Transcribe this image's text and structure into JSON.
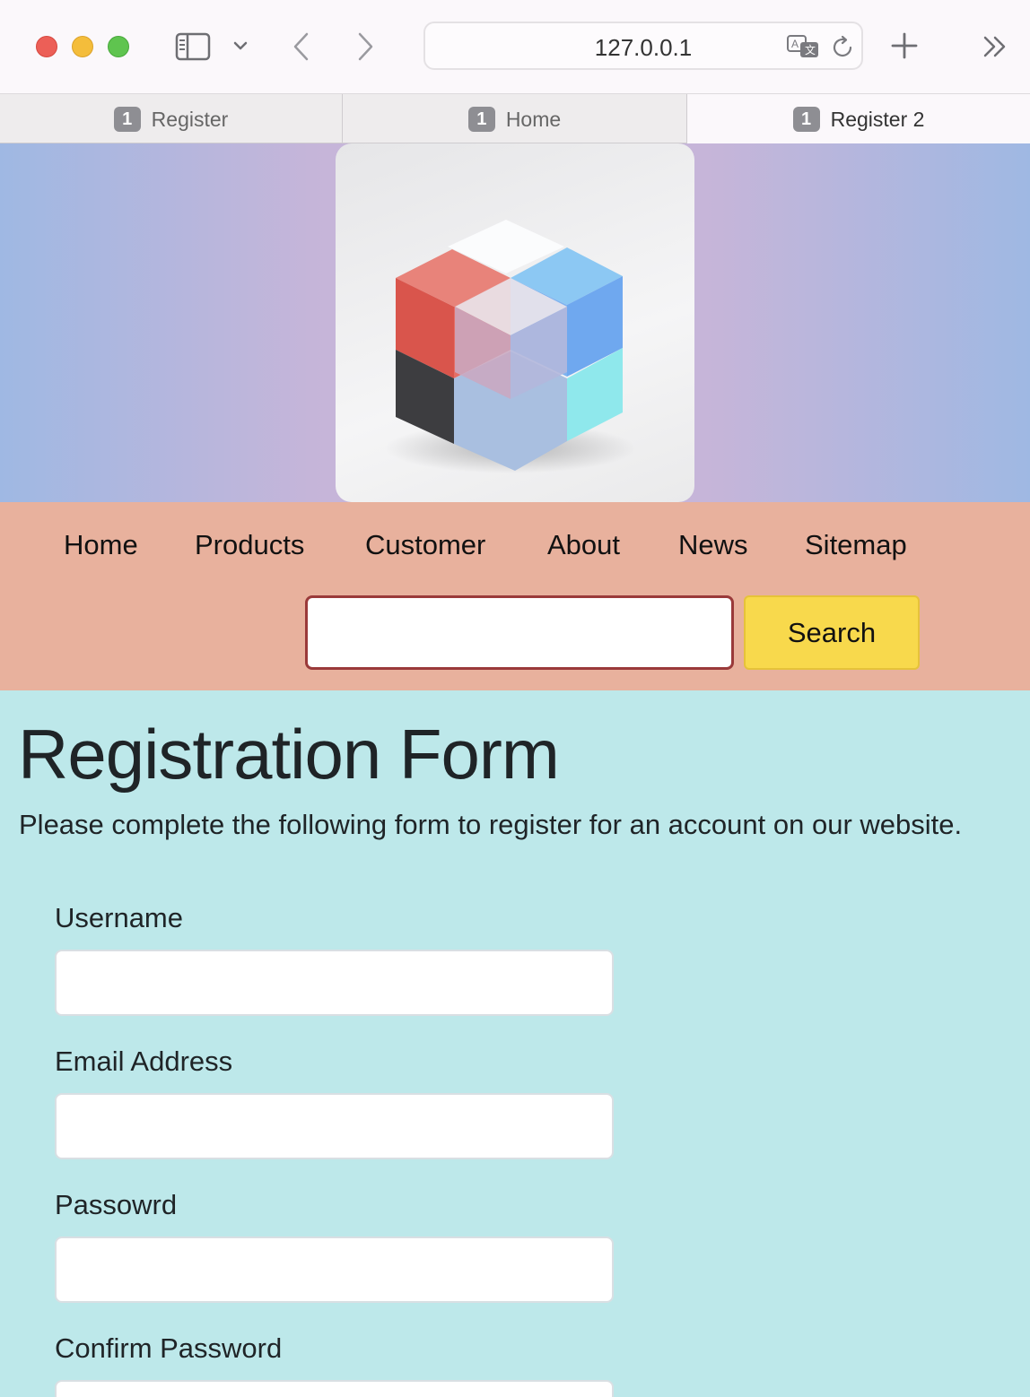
{
  "browser": {
    "url": "127.0.0.1",
    "tabs": [
      {
        "badge": "1",
        "label": "Register"
      },
      {
        "badge": "1",
        "label": "Home"
      },
      {
        "badge": "1",
        "label": "Register 2"
      }
    ],
    "active_tab": "Register 2"
  },
  "nav": {
    "links": [
      "Home",
      "Products",
      "Customer",
      "About",
      "News",
      "Sitemap"
    ],
    "search_button": "Search",
    "search_value": ""
  },
  "form": {
    "title": "Registration Form",
    "intro": "Please complete the following form to register for an account on our website.",
    "fields": [
      {
        "label": "Username",
        "value": ""
      },
      {
        "label": "Email Address",
        "value": ""
      },
      {
        "label": "Passowrd",
        "value": ""
      },
      {
        "label": "Confirm Password",
        "value": ""
      }
    ]
  },
  "colors": {
    "nav_background": "#e8b19d",
    "form_background": "#bde8ea",
    "search_button": "#f8d94c",
    "search_border": "#9a3a3a"
  },
  "icons": [
    "sidebar-icon",
    "chevron-down-icon",
    "back-icon",
    "forward-icon",
    "translate-icon",
    "reload-icon",
    "plus-icon",
    "chevrons-right-icon",
    "cube-logo"
  ]
}
